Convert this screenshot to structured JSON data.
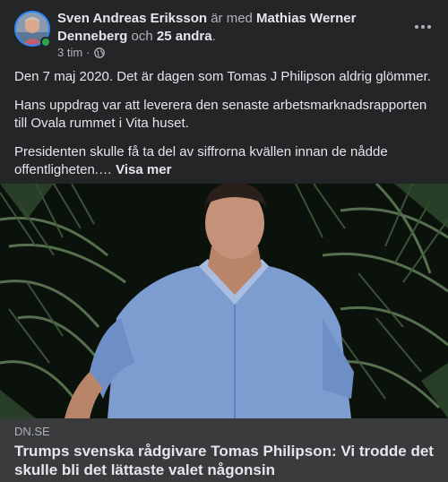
{
  "post": {
    "author": "Sven Andreas Eriksson",
    "with_text": "är med",
    "tagged_person": "Mathias Werner Denneberg",
    "and_text": "och",
    "others": "25 andra",
    "trailing": ".",
    "time": "3 tim",
    "separator": "·",
    "privacy_icon": "globe-icon",
    "paragraphs": [
      "Den 7 maj 2020. Det är dagen som Tomas J Philipson aldrig glömmer.",
      "Hans uppdrag var att leverera den senaste arbetsmarknadsrapporten till Ovala rummet i Vita huset.",
      "Presidenten skulle få ta del av siffrorna kvällen innan de nådde offentligheten.…"
    ],
    "see_more": "Visa mer"
  },
  "link": {
    "domain": "DN.SE",
    "title": "Trumps svenska rådgivare Tomas Philipson: Vi trodde det skulle bli det lättaste valet någonsin"
  },
  "colors": {
    "background": "#242526",
    "preview_background": "#3a3b3c",
    "primary_text": "#e4e6eb",
    "secondary_text": "#b0b3b8",
    "online": "#31a24c"
  }
}
